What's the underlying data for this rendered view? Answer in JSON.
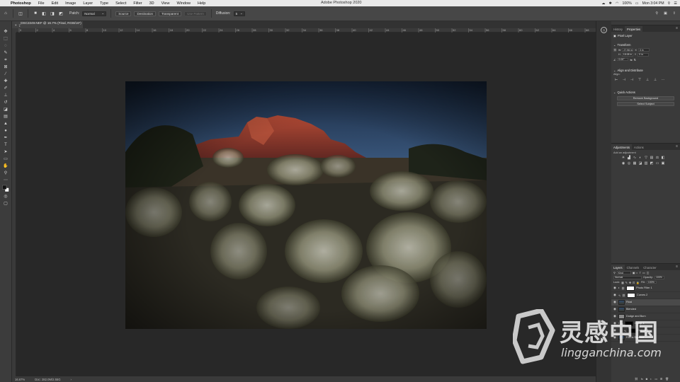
{
  "menubar": {
    "app": "Photoshop",
    "items": [
      "File",
      "Edit",
      "Image",
      "Layer",
      "Type",
      "Select",
      "Filter",
      "3D",
      "View",
      "Window",
      "Help"
    ],
    "window_title": "Adobe Photoshop 2020",
    "battery": "100%",
    "clock": "Mon 3:04 PM"
  },
  "options": {
    "patch_label": "Patch:",
    "patch_value": "Normal",
    "source": "Source",
    "destination": "Destination",
    "transparent": "Transparent",
    "use_pattern": "Use Pattern",
    "diffusion_label": "Diffusion:",
    "diffusion_value": "5"
  },
  "document": {
    "tab_title": "_DSC2249.NEF @ 16.7% (Final, RGB/16*) *",
    "zoom": "16.67%",
    "doc_info": "Doc: 282.0M/2.55G"
  },
  "ruler": {
    "marks": [
      "0",
      "2",
      "4",
      "6",
      "8",
      "10",
      "12",
      "14",
      "16",
      "18",
      "20",
      "22",
      "24",
      "26",
      "28",
      "30",
      "32",
      "34",
      "36",
      "38",
      "40",
      "42",
      "44",
      "46",
      "48",
      "50",
      "52",
      "54",
      "56",
      "58",
      "60",
      "62",
      "64",
      "66",
      "68"
    ]
  },
  "panels": {
    "history_tab": "History",
    "properties_tab": "Properties",
    "pixel_layer": "Pixel Layer",
    "transform": "Transform",
    "w_label": "W",
    "w_value": "27.96 in",
    "h_label": "H",
    "h_value": "18.08 in",
    "x_label": "X",
    "x_value": "0 in",
    "y_label": "Y",
    "y_value": "0 in",
    "angle_value": "0.00°",
    "align_title": "Align and Distribute",
    "align_label": "Align:",
    "quick_actions": "Quick Actions",
    "remove_background": "Remove Background",
    "select_subject": "Select Subject",
    "adjustments_tab": "Adjustments",
    "actions_tab": "Actions",
    "add_adjustment": "Add an adjustment",
    "layers_tab": "Layers",
    "channels_tab": "Channels",
    "character_tab": "Character",
    "kind": "Kind",
    "blend_mode": "Normal",
    "opacity_label": "Opacity:",
    "opacity_value": "100%",
    "lock_label": "Lock:",
    "fill_label": "Fill:",
    "fill_value": "100%"
  },
  "layers": [
    {
      "name": "Photo Filter 1",
      "type": "adjust"
    },
    {
      "name": "Curves 2",
      "type": "adjust"
    },
    {
      "name": "Final",
      "type": "pixel",
      "selected": true
    },
    {
      "name": "Blended",
      "type": "pixel"
    },
    {
      "name": "Dodge and Burn",
      "type": "pixel"
    },
    {
      "name": "Group 1",
      "type": "group"
    },
    {
      "name": "Curves 1",
      "type": "mask-black"
    },
    {
      "name": "Focus Stacked",
      "type": "pixel"
    }
  ],
  "watermark": {
    "cn": "灵感中国",
    "url": "lingganchina.com"
  },
  "colors": {
    "ui_dark": "#282828",
    "panel": "#3a3a3a",
    "sky_top": "#1c3150",
    "rock": "#8a3428"
  }
}
